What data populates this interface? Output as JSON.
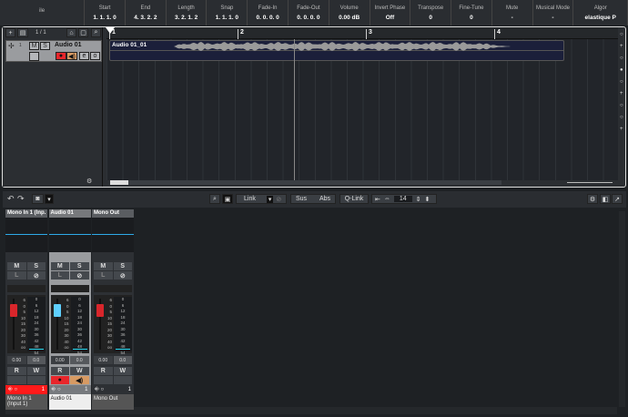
{
  "infoline": [
    {
      "label": "ile",
      "value": ""
    },
    {
      "label": "Start",
      "value": "1. 1. 1.   0"
    },
    {
      "label": "End",
      "value": "4. 3. 2.   2"
    },
    {
      "label": "Length",
      "value": "3. 2. 1.   2"
    },
    {
      "label": "Snap",
      "value": "1. 1. 1.   0"
    },
    {
      "label": "Fade-In",
      "value": "0. 0. 0.   0"
    },
    {
      "label": "Fade-Out",
      "value": "0. 0. 0.   0"
    },
    {
      "label": "Volume",
      "value": "0.00        dB"
    },
    {
      "label": "Invert Phase",
      "value": "Off"
    },
    {
      "label": "Transpose",
      "value": "0"
    },
    {
      "label": "Fine-Tune",
      "value": "0"
    },
    {
      "label": "Mute",
      "value": "-"
    },
    {
      "label": "Musical Mode",
      "value": "-"
    },
    {
      "label": "Algor",
      "value": "elastique P"
    }
  ],
  "project": {
    "counter": "1 / 1",
    "track": {
      "number": "1",
      "name": "Audio 01",
      "mute": "M",
      "solo": "S"
    },
    "event_name": "Audio 01_01",
    "bars": [
      "1",
      "2",
      "3",
      "4"
    ]
  },
  "mixer_toolbar": {
    "link": "Link",
    "sus": "Sus",
    "abs": "Abs",
    "qlink": "Q-Link",
    "width_value": "14"
  },
  "channels": [
    {
      "header": "Mono In 1 (Inp.",
      "name": "Mono In 1 (Input 1)",
      "fader_value": "0.00",
      "meter_value": "0.0",
      "fader_color": "#d9262b",
      "footer_color": "#ff1a1a",
      "selected": false,
      "number": "1"
    },
    {
      "header": "Audio 01",
      "name": "Audio 01",
      "fader_value": "0.00",
      "meter_value": "0.0",
      "fader_color": "#5fd0ff",
      "footer_color": "#777a7e",
      "selected": true,
      "number": "1"
    },
    {
      "header": "Mono Out",
      "name": "Mono Out",
      "fader_value": "0.00",
      "meter_value": "0.0",
      "fader_color": "#d9262b",
      "footer_color": "#2d3034",
      "selected": false,
      "number": "1"
    }
  ],
  "strip_labels": {
    "mute": "M",
    "solo": "S",
    "listen": "L",
    "read": "R",
    "write": "W"
  },
  "fader_scale": [
    "6",
    "0",
    "5",
    "10",
    "15",
    "20",
    "30",
    "40",
    "oo"
  ],
  "meter_scale": [
    "0",
    "6",
    "12",
    "18",
    "24",
    "30",
    "36",
    "42",
    "48",
    "54"
  ]
}
